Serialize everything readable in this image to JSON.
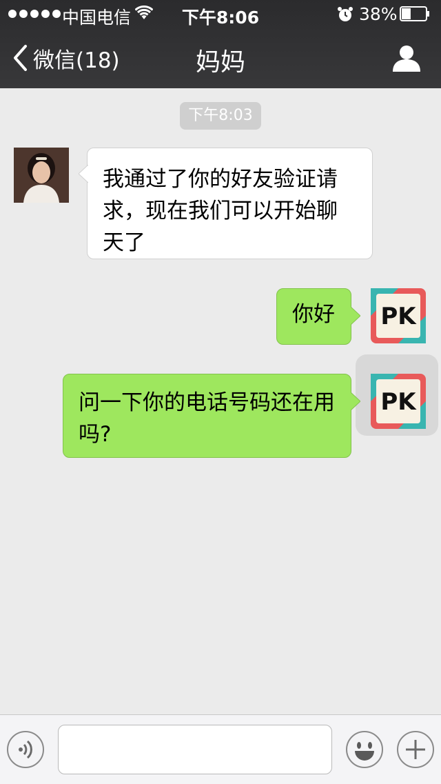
{
  "status_bar": {
    "carrier": "中国电信",
    "time": "下午8:06",
    "battery_percent": "38%",
    "battery_level": 0.38
  },
  "nav": {
    "back_label": "微信(18)",
    "title": "妈妈"
  },
  "chat": {
    "timestamp": "下午8:03",
    "messages": [
      {
        "direction": "incoming",
        "sender": "妈妈",
        "text": "我通过了你的好友验证请求，现在我们可以开始聊天了"
      },
      {
        "direction": "outgoing",
        "text": "你好"
      },
      {
        "direction": "outgoing",
        "text": "问一下你的电话号码还在用吗?"
      }
    ],
    "avatar_badge_text": "PK"
  },
  "input": {
    "value": "",
    "placeholder": ""
  },
  "colors": {
    "header_bg": "#2e2e30",
    "chat_bg": "#ebebeb",
    "outgoing_bubble": "#9ee75e",
    "incoming_bubble": "#ffffff"
  },
  "icons": {
    "back": "chevron-left-icon",
    "profile": "person-icon",
    "voice": "voice-icon",
    "emoji": "smiley-icon",
    "plus": "plus-icon",
    "wifi": "wifi-icon",
    "alarm": "alarm-clock-icon",
    "battery": "battery-icon"
  }
}
